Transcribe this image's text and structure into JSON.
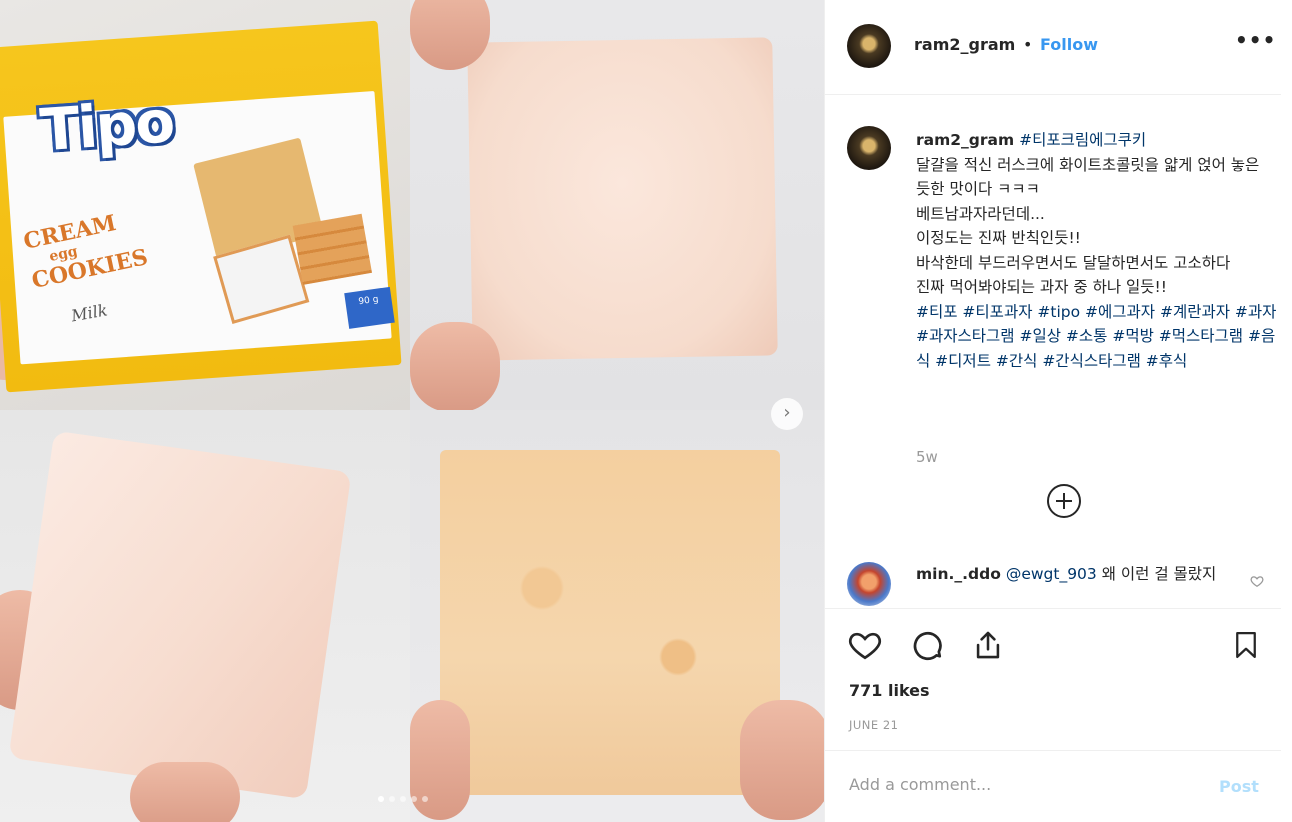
{
  "post": {
    "username": "ram2_gram",
    "separator": "•",
    "follow_label": "Follow",
    "more_label": "•••"
  },
  "product_image": {
    "brand": "Tipo",
    "title_line1": "CREAM",
    "title_line2": "egg",
    "title_line3": "COOKIES",
    "flavor": "Milk",
    "weight": "90 g"
  },
  "caption": {
    "username": "ram2_gram",
    "title_tag": "#티포크림에그쿠키",
    "lines": [
      "달걀을 적신 러스크에 화이트초콜릿을 얇게 얹어 놓은 듯한 맛이다 ㅋㅋㅋ",
      "베트남과자라던데...",
      "이정도는 진짜 반칙인듯!!",
      "바삭한데 부드러우면서도 달달하면서도 고소하다",
      "진짜 먹어봐야되는 과자 중 하나 일듯!!"
    ],
    "hashtags": "#티포 #티포과자 #tipo #에그과자 #계란과자 #과자 #과자스타그램 #일상 #소통 #먹방 #먹스타그램 #음식 #디저트 #간식 #간식스타그램 #후식",
    "time": "5w"
  },
  "comment": {
    "username": "min._.ddo",
    "mention": "@ewgt_903",
    "text": "왜 이런 걸 몰랐지"
  },
  "stats": {
    "likes": "771 likes",
    "date": "JUNE 21"
  },
  "composer": {
    "placeholder": "Add a comment...",
    "post_label": "Post"
  },
  "carousel": {
    "next_label": "›",
    "dot_count": 5,
    "active_index": 0
  },
  "colors": {
    "link": "#3897f0",
    "hashtag": "#003569",
    "muted": "#999999"
  }
}
